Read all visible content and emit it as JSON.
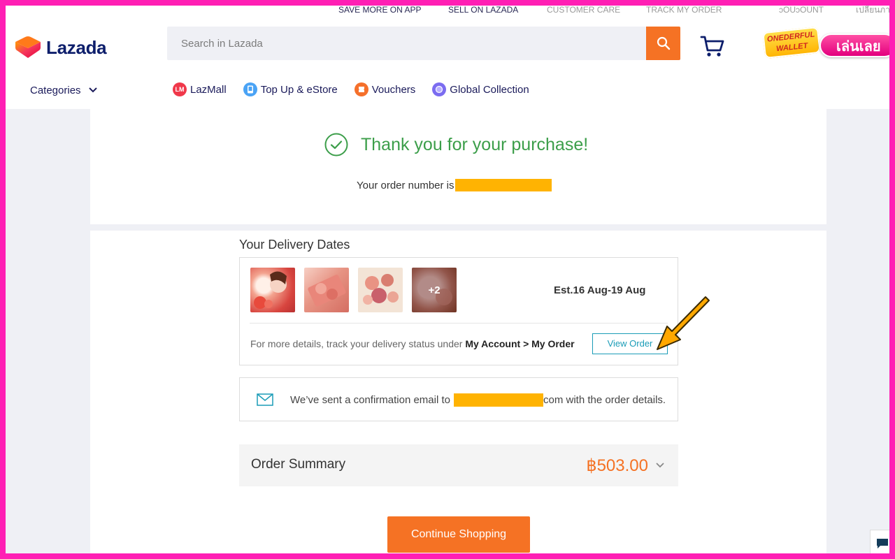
{
  "top_links": [
    "SAVE MORE ON APP",
    "SELL ON LAZADA",
    "CUSTOMER CARE",
    "TRACK MY ORDER",
    "ɔOUɔOUNT",
    "เปลี่ยนภา"
  ],
  "header": {
    "logo_text": "Lazada",
    "search_placeholder": "Search in Lazada",
    "promo_wallet": "ONEDERFUL WALLET",
    "promo_play": "เล่นเลย",
    "categories_label": "Categories",
    "nav": [
      {
        "label": "LazMall",
        "icon": "lazmall-icon",
        "color": "#f0384a"
      },
      {
        "label": "Top Up & eStore",
        "icon": "topup-icon",
        "color": "#4aa3f5"
      },
      {
        "label": "Vouchers",
        "icon": "voucher-icon",
        "color": "#f5702b"
      },
      {
        "label": "Global Collection",
        "icon": "global-icon",
        "color": "#7b6cf0"
      }
    ]
  },
  "confirmation": {
    "title": "Thank you for your purchase!",
    "order_number_prefix": "Your order number is"
  },
  "delivery": {
    "title": "Your Delivery Dates",
    "more_count": "+2",
    "estimate": "Est.16 Aug-19 Aug",
    "track_prefix": "For more details, track your delivery status under",
    "track_path": "My Account > My Order",
    "view_order_label": "View Order"
  },
  "email": {
    "prefix": "We’ve sent a confirmation email to",
    "suffix": "com with the order details."
  },
  "summary": {
    "label": "Order Summary",
    "total": "฿503.00"
  },
  "continue_label": "Continue Shopping",
  "colors": {
    "brand_orange": "#f57224",
    "success_green": "#3c9e4a",
    "link_teal": "#1a9cb7",
    "annotation_arrow": "#ffa800",
    "redaction": "#ffb302",
    "frame_border": "#ff1fb4"
  }
}
